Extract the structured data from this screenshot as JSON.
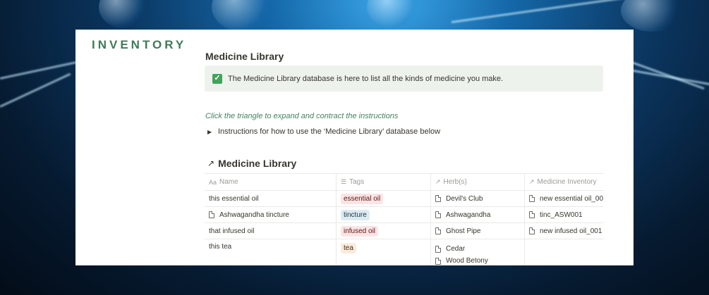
{
  "brand": "INVENTORY",
  "page_title": "Medicine Library",
  "callout": {
    "icon": "check-icon",
    "text": "The Medicine Library database is here to list all the kinds of medicine you make."
  },
  "instructions_hint": "Click the triangle to expand and contract the instructions",
  "toggle_label": "Instructions for how to use the ‘Medicine Library’ database below",
  "database": {
    "title": "Medicine Library",
    "columns": [
      "Name",
      "Tags",
      "Herb(s)",
      "Medicine Inventory"
    ],
    "rows": [
      {
        "name": "this essential oil",
        "tag": "essential oil",
        "herbs": [
          "Devil's Club"
        ],
        "inventory": "new essential oil_00"
      },
      {
        "name": "Ashwagandha tincture",
        "tag": "tincture",
        "herbs": [
          "Ashwagandha"
        ],
        "inventory": "tinc_ASW001"
      },
      {
        "name": "that infused oil",
        "tag": "infused oil",
        "herbs": [
          "Ghost Pipe"
        ],
        "inventory": "new infused oil_001"
      },
      {
        "name": "this tea",
        "tag": "tea",
        "herbs": [
          "Cedar",
          "Wood Betony"
        ],
        "inventory": ""
      }
    ]
  },
  "colors": {
    "brand": "#3f7a5a",
    "callout_bg": "#edf3ec",
    "hint": "#448361",
    "tag_oil": "#fbe4e4",
    "tag_tincture": "#ddebf1",
    "tag_tea": "#faebdd"
  }
}
